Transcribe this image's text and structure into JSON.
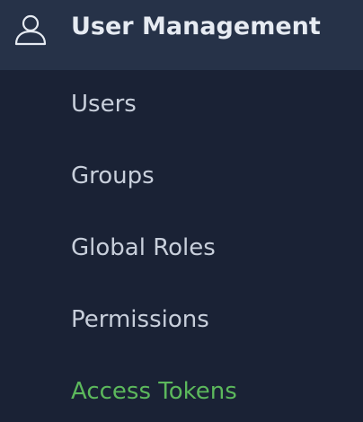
{
  "section": {
    "icon": "user-icon",
    "title": "User Management"
  },
  "nav": {
    "items": [
      {
        "label": "Users",
        "active": false
      },
      {
        "label": "Groups",
        "active": false
      },
      {
        "label": "Global Roles",
        "active": false
      },
      {
        "label": "Permissions",
        "active": false
      },
      {
        "label": "Access Tokens",
        "active": true
      }
    ]
  },
  "colors": {
    "background": "#1a2235",
    "header_background": "#263248",
    "text": "#c8cfdb",
    "header_text": "#e6ebf2",
    "active": "#5cb85c"
  }
}
